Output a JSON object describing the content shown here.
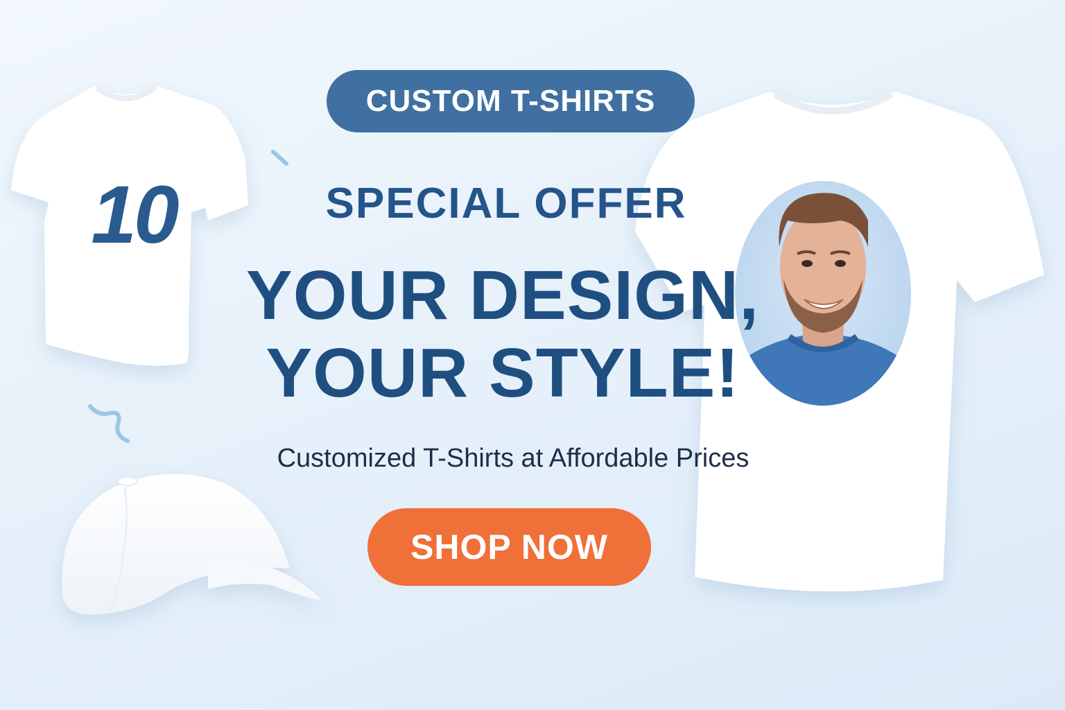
{
  "banner": {
    "tag": "CUSTOM T-SHIRTS",
    "offer": "SPECIAL OFFER",
    "headline_line1": "YOUR DESIGN,",
    "headline_line2": "YOUR STYLE!",
    "subline": "Customized T-Shirts at Affordable Prices",
    "cta_label": "SHOP NOW",
    "shirt_number": "10"
  },
  "colors": {
    "pill": "#3f70a1",
    "heading": "#1f4f80",
    "cta": "#ef7038",
    "background": "#e7f1fa"
  },
  "icons": [
    "t-shirt-number-icon",
    "baseball-cap-icon",
    "t-shirt-photo-icon",
    "squiggle-icon"
  ]
}
